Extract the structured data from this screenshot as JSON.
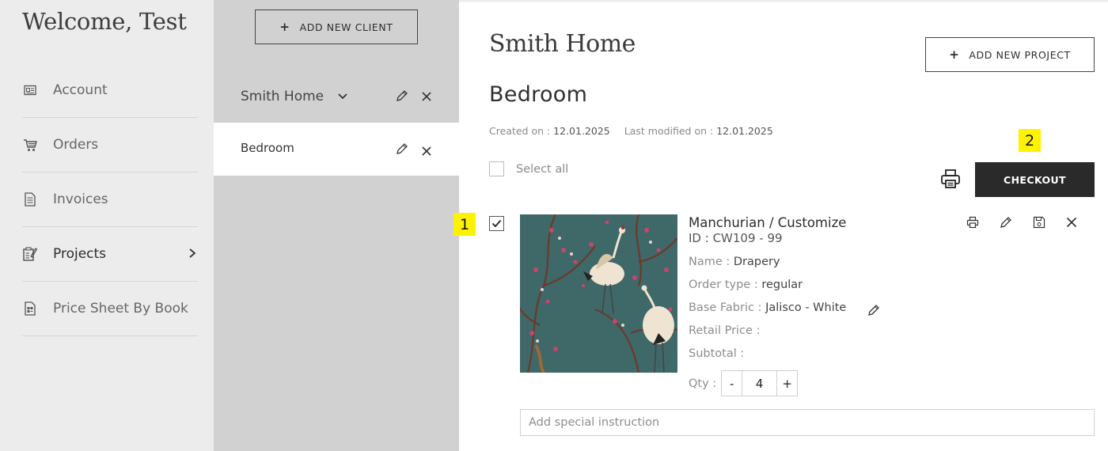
{
  "nav": {
    "welcome": "Welcome, Test",
    "items": [
      {
        "label": "Account",
        "icon": "account-card-icon"
      },
      {
        "label": "Orders",
        "icon": "cart-icon"
      },
      {
        "label": "Invoices",
        "icon": "document-icon"
      },
      {
        "label": "Projects",
        "icon": "projects-icon",
        "active": true
      },
      {
        "label": "Price Sheet By Book",
        "icon": "price-sheet-icon"
      }
    ]
  },
  "clients": {
    "add_label": "ADD NEW CLIENT",
    "client_name": "Smith Home",
    "project_name": "Bedroom"
  },
  "main": {
    "client_title": "Smith Home",
    "add_project_label": "ADD NEW PROJECT",
    "project_title": "Bedroom",
    "created_label": "Created on : ",
    "created_value": "12.01.2025",
    "modified_label": "Last modified on : ",
    "modified_value": "12.01.2025",
    "select_all_label": "Select all",
    "checkout_label": "CHECKOUT",
    "badge_1": "1",
    "badge_2": "2"
  },
  "item": {
    "title": "Manchurian / Customize",
    "id": "ID : CW109 - 99",
    "name_label": "Name : ",
    "name_value": "Drapery",
    "order_type_label": "Order type : ",
    "order_type_value": "regular",
    "base_fabric_label": "Base Fabric : ",
    "base_fabric_value": "Jalisco - White",
    "retail_price_label": "Retail Price :",
    "subtotal_label": "Subtotal :",
    "qty_label": "Qty :",
    "qty_minus": "-",
    "qty_value": "4",
    "qty_plus": "+",
    "checked": true,
    "special_instruction_placeholder": "Add special instruction"
  },
  "colors": {
    "nav_bg": "#ececec",
    "client_col_bg": "#d1d1d1",
    "checkout_bg": "#2a2a2a",
    "badge": "#fff200",
    "swatch_bg": "#3f6868"
  }
}
